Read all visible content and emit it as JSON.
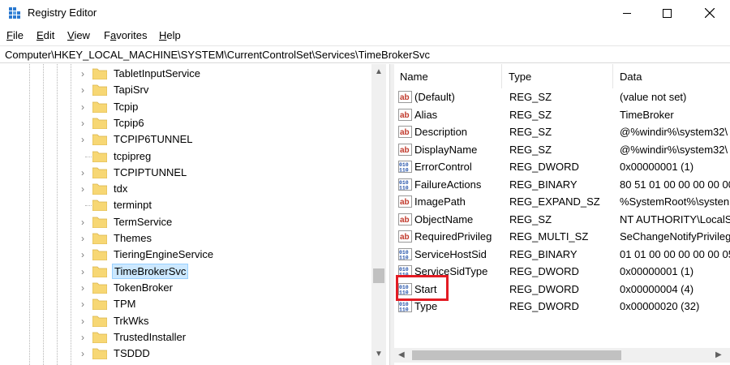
{
  "window": {
    "title": "Registry Editor"
  },
  "menu": [
    {
      "accel": "F",
      "rest": "ile"
    },
    {
      "accel": "E",
      "rest": "dit"
    },
    {
      "accel": "V",
      "rest": "iew"
    },
    {
      "accel": "",
      "rest": "F",
      "accel2": "a",
      "rest2": "vorites"
    },
    {
      "accel": "H",
      "rest": "elp"
    }
  ],
  "address": "Computer\\HKEY_LOCAL_MACHINE\\SYSTEM\\CurrentControlSet\\Services\\TimeBrokerSvc",
  "tree": {
    "items": [
      {
        "label": "TabletInputService",
        "expandable": true
      },
      {
        "label": "TapiSrv",
        "expandable": true
      },
      {
        "label": "Tcpip",
        "expandable": true
      },
      {
        "label": "Tcpip6",
        "expandable": true
      },
      {
        "label": "TCPIP6TUNNEL",
        "expandable": true
      },
      {
        "label": "tcpipreg",
        "expandable": false
      },
      {
        "label": "TCPIPTUNNEL",
        "expandable": true
      },
      {
        "label": "tdx",
        "expandable": true
      },
      {
        "label": "terminpt",
        "expandable": false
      },
      {
        "label": "TermService",
        "expandable": true
      },
      {
        "label": "Themes",
        "expandable": true
      },
      {
        "label": "TieringEngineService",
        "expandable": true
      },
      {
        "label": "TimeBrokerSvc",
        "expandable": true,
        "selected": true
      },
      {
        "label": "TokenBroker",
        "expandable": true
      },
      {
        "label": "TPM",
        "expandable": true
      },
      {
        "label": "TrkWks",
        "expandable": true
      },
      {
        "label": "TrustedInstaller",
        "expandable": true
      },
      {
        "label": "TSDDD",
        "expandable": true
      }
    ]
  },
  "values": {
    "headers": {
      "name": "Name",
      "type": "Type",
      "data": "Data"
    },
    "rows": [
      {
        "icon": "string-value-icon",
        "name": "(Default)",
        "type": "REG_SZ",
        "data": "(value not set)"
      },
      {
        "icon": "string-value-icon",
        "name": "Alias",
        "type": "REG_SZ",
        "data": "TimeBroker"
      },
      {
        "icon": "string-value-icon",
        "name": "Description",
        "type": "REG_SZ",
        "data": "@%windir%\\system32\\"
      },
      {
        "icon": "string-value-icon",
        "name": "DisplayName",
        "type": "REG_SZ",
        "data": "@%windir%\\system32\\"
      },
      {
        "icon": "binary-value-icon",
        "name": "ErrorControl",
        "type": "REG_DWORD",
        "data": "0x00000001 (1)"
      },
      {
        "icon": "binary-value-icon",
        "name": "FailureActions",
        "type": "REG_BINARY",
        "data": "80 51 01 00 00 00 00 00"
      },
      {
        "icon": "string-value-icon",
        "name": "ImagePath",
        "type": "REG_EXPAND_SZ",
        "data": "%SystemRoot%\\systen"
      },
      {
        "icon": "string-value-icon",
        "name": "ObjectName",
        "type": "REG_SZ",
        "data": "NT AUTHORITY\\LocalS"
      },
      {
        "icon": "string-value-icon",
        "name": "RequiredPrivileg",
        "type": "REG_MULTI_SZ",
        "data": "SeChangeNotifyPrivileg"
      },
      {
        "icon": "binary-value-icon",
        "name": "ServiceHostSid",
        "type": "REG_BINARY",
        "data": "01 01 00 00 00 00 00 05"
      },
      {
        "icon": "binary-value-icon",
        "name": "ServiceSidType",
        "type": "REG_DWORD",
        "data": "0x00000001 (1)"
      },
      {
        "icon": "binary-value-icon",
        "name": "Start",
        "type": "REG_DWORD",
        "data": "0x00000004 (4)",
        "highlighted": true
      },
      {
        "icon": "binary-value-icon",
        "name": "Type",
        "type": "REG_DWORD",
        "data": "0x00000020 (32)"
      }
    ]
  },
  "colors": {
    "selection": "#cce8ff",
    "highlight_box": "#e31b23",
    "folder": "#f7d774",
    "string_icon": "#c0392b",
    "binary_icon": "#1f4fa8"
  }
}
